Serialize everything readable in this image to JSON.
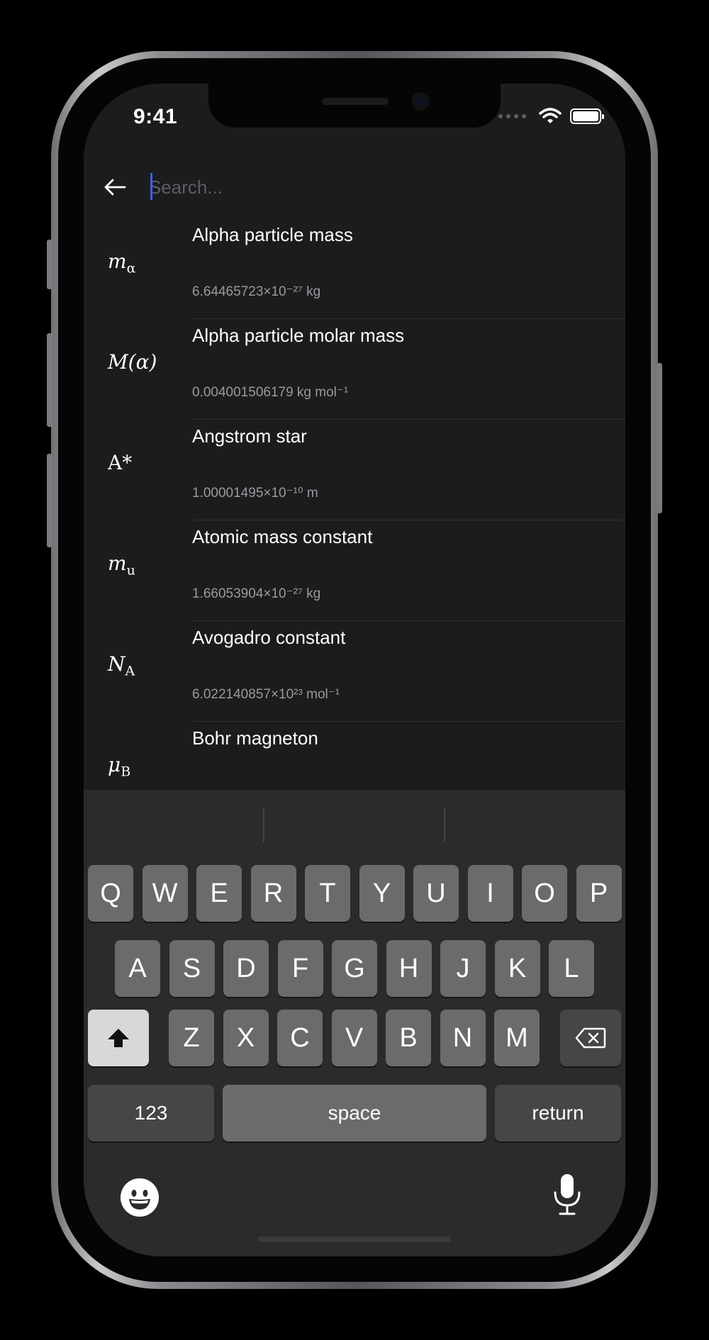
{
  "status": {
    "time": "9:41"
  },
  "search": {
    "placeholder": "Search..."
  },
  "constants": [
    {
      "symbol": "m",
      "sub": "α",
      "name": "Alpha particle mass",
      "value": "6.64465723×10⁻²⁷ kg"
    },
    {
      "symbol": "M(α)",
      "sub": "",
      "name": "Alpha particle molar mass",
      "value": "0.004001506179 kg mol⁻¹"
    },
    {
      "symbol": "A*",
      "sub": "",
      "name": "Angstrom star",
      "value": "1.00001495×10⁻¹⁰ m"
    },
    {
      "symbol": "m",
      "sub": "u",
      "name": "Atomic mass constant",
      "value": "1.66053904×10⁻²⁷ kg"
    },
    {
      "symbol": "N",
      "sub": "A",
      "name": "Avogadro constant",
      "value": "6.022140857×10²³ mol⁻¹"
    },
    {
      "symbol": "μ",
      "sub": "B",
      "name": "Bohr magneton",
      "value": ""
    }
  ],
  "keyboard": {
    "row1": [
      "Q",
      "W",
      "E",
      "R",
      "T",
      "Y",
      "U",
      "I",
      "O",
      "P"
    ],
    "row2": [
      "A",
      "S",
      "D",
      "F",
      "G",
      "H",
      "J",
      "K",
      "L"
    ],
    "row3": [
      "Z",
      "X",
      "C",
      "V",
      "B",
      "N",
      "M"
    ],
    "numbers_label": "123",
    "space_label": "space",
    "return_label": "return"
  },
  "icons": {
    "back": "arrow-left-icon",
    "shift": "shift-icon",
    "delete": "backspace-icon",
    "emoji": "emoji-icon",
    "mic": "microphone-icon",
    "wifi": "wifi-icon",
    "battery": "battery-icon"
  }
}
